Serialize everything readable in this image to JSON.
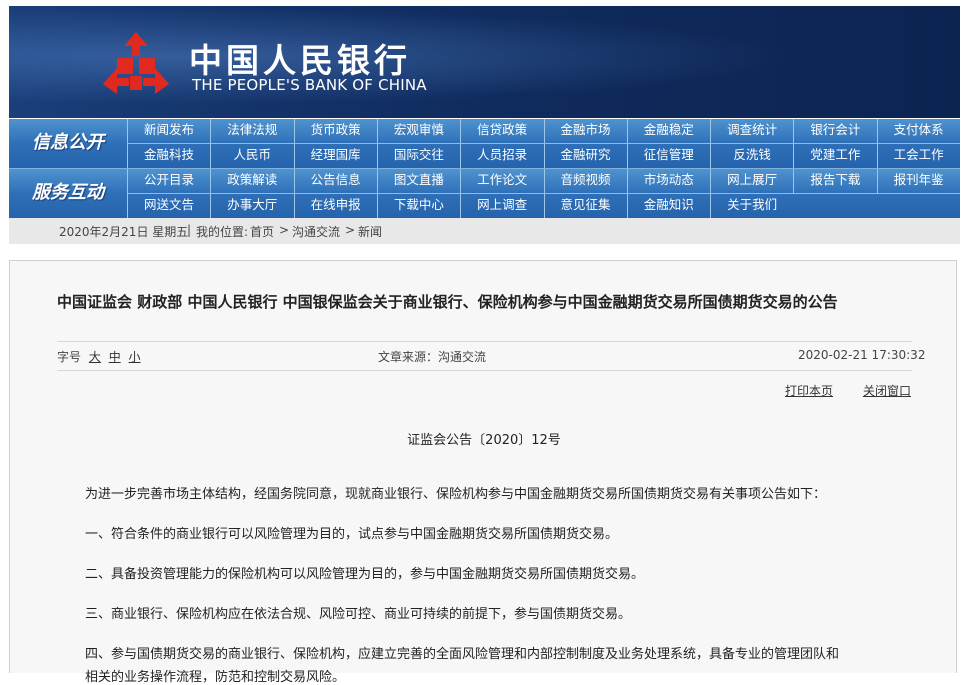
{
  "banner": {
    "name_cn": "中国人民银行",
    "name_en": "THE PEOPLE'S BANK OF CHINA"
  },
  "nav": {
    "row1_label": "信息公开",
    "row1_items": [
      "新闻发布",
      "法律法规",
      "货币政策",
      "宏观审慎",
      "信贷政策",
      "金融市场",
      "金融稳定",
      "调查统计",
      "银行会计",
      "支付体系",
      "金融科技",
      "人民币",
      "经理国库",
      "国际交往",
      "人员招录",
      "金融研究",
      "征信管理",
      "反洗钱",
      "党建工作",
      "工会工作"
    ],
    "row2_label": "服务互动",
    "row2_items": [
      "公开目录",
      "政策解读",
      "公告信息",
      "图文直播",
      "工作论文",
      "音频视频",
      "市场动态",
      "网上展厅",
      "报告下载",
      "报刊年鉴",
      "网送文告",
      "办事大厅",
      "在线申报",
      "下载中心",
      "网上调查",
      "意见征集",
      "金融知识",
      "关于我们"
    ]
  },
  "crumb": {
    "date": "2020年2月21日 星期五",
    "location_label": "我的位置:",
    "items": [
      "首页",
      "沟通交流",
      "新闻"
    ],
    "sep": ">"
  },
  "article": {
    "title": "中国证监会 财政部 中国人民银行 中国银保监会关于商业银行、保险机构参与中国金融期货交易所国债期货交易的公告",
    "font_label": "字号",
    "font_sizes": [
      "大",
      "中",
      "小"
    ],
    "source": "文章来源：沟通交流",
    "datetime": "2020-02-21 17:30:32",
    "print": "打印本页",
    "close": "关闭窗口",
    "doc_no": "证监会公告〔2020〕12号",
    "paragraphs": [
      "为进一步完善市场主体结构，经国务院同意，现就商业银行、保险机构参与中国金融期货交易所国债期货交易有关事项公告如下：",
      "一、符合条件的商业银行可以风险管理为目的，试点参与中国金融期货交易所国债期货交易。",
      "二、具备投资管理能力的保险机构可以风险管理为目的，参与中国金融期货交易所国债期货交易。",
      "三、商业银行、保险机构应在依法合规、风险可控、商业可持续的前提下，参与国债期货交易。",
      "四、参与国债期货交易的商业银行、保险机构，应建立完善的全面风险管理和内部控制制度及业务处理系统，具备专业的管理团队和",
      "相关的业务操作流程，防范和控制交易风险。"
    ]
  },
  "colors": {
    "banner": "#0f2a5c",
    "nav": "#2e70b8"
  }
}
